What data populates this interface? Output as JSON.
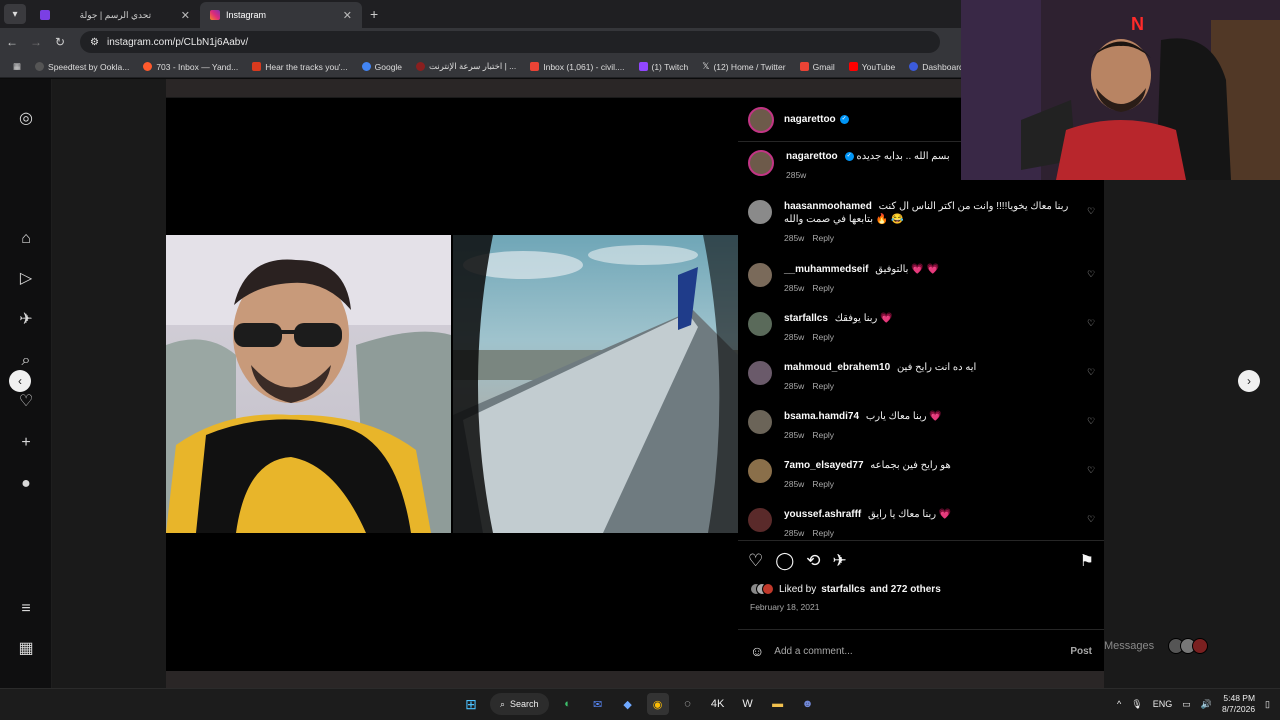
{
  "browser": {
    "tabs": [
      {
        "label": "تحدي الرسم | جولة",
        "active": false
      },
      {
        "label": "Instagram",
        "active": true
      }
    ],
    "url": "instagram.com/p/CLbN1j6Aabv/",
    "bookmarks": [
      {
        "label": "Speedtest by Ookla...",
        "color": "#2c2c2c"
      },
      {
        "label": "703 - Inbox — Yand...",
        "color": "#ff5a2c"
      },
      {
        "label": "Hear the tracks you'...",
        "color": "#d83a1e"
      },
      {
        "label": "Google",
        "color": "#4285f4"
      },
      {
        "label": "اختبار سرعة الإنترنت | ...",
        "color": "#8a1f1f"
      },
      {
        "label": "Inbox (1,061) - civil....",
        "color": "#ea4335"
      },
      {
        "label": "(1) Twitch",
        "color": "#9146ff"
      },
      {
        "label": "(12) Home / Twitter",
        "color": "#ffffff"
      },
      {
        "label": "Gmail",
        "color": "#ea4335"
      },
      {
        "label": "YouTube",
        "color": "#ff0000"
      },
      {
        "label": "Dashboard - Restre...",
        "color": "#3b5bdb"
      }
    ]
  },
  "post": {
    "author": "nagarettoo",
    "caption": "بسم الله .. بدايه جديده",
    "caption_time": "285w",
    "likes_text_prefix": "Liked by",
    "likes_user": "starfallcs",
    "likes_text_suffix": "and 272 others",
    "date": "February 18, 2021",
    "add_comment_placeholder": "Add a comment...",
    "post_button": "Post",
    "comments": [
      {
        "user": "haasanmoohamed",
        "text": "ربنا معاك يخويا!!!! وانت من اكتر الناس ال كنت بتابعها في صمت والله 🔥 😂",
        "time": "285w",
        "reply": "Reply"
      },
      {
        "user": "__muhammedseif",
        "text": "بالتوفيق 💗 💗",
        "time": "285w",
        "reply": "Reply"
      },
      {
        "user": "starfallcs",
        "text": "ربنا يوفقك 💗",
        "time": "285w",
        "reply": "Reply"
      },
      {
        "user": "mahmoud_ebrahem10",
        "text": "ايه ده انت رايح فين",
        "time": "285w",
        "reply": "Reply"
      },
      {
        "user": "bsama.hamdi74",
        "text": "ربنا معاك يارب 💗",
        "time": "285w",
        "reply": "Reply"
      },
      {
        "user": "7amo_elsayed77",
        "text": "هو رايح فين بجماعه",
        "time": "285w",
        "reply": "Reply"
      },
      {
        "user": "youssef.ashrafff",
        "text": "ربنا معاك يا رايق 💗",
        "time": "285w",
        "reply": "Reply"
      }
    ]
  },
  "messages_label": "Messages",
  "taskbar": {
    "search_label": "Search",
    "lang": "ENG",
    "time": "5:48 PM",
    "date": "8/7/2026"
  },
  "icons": {
    "accent": "#0095f6",
    "story_ring": "#c13584"
  }
}
